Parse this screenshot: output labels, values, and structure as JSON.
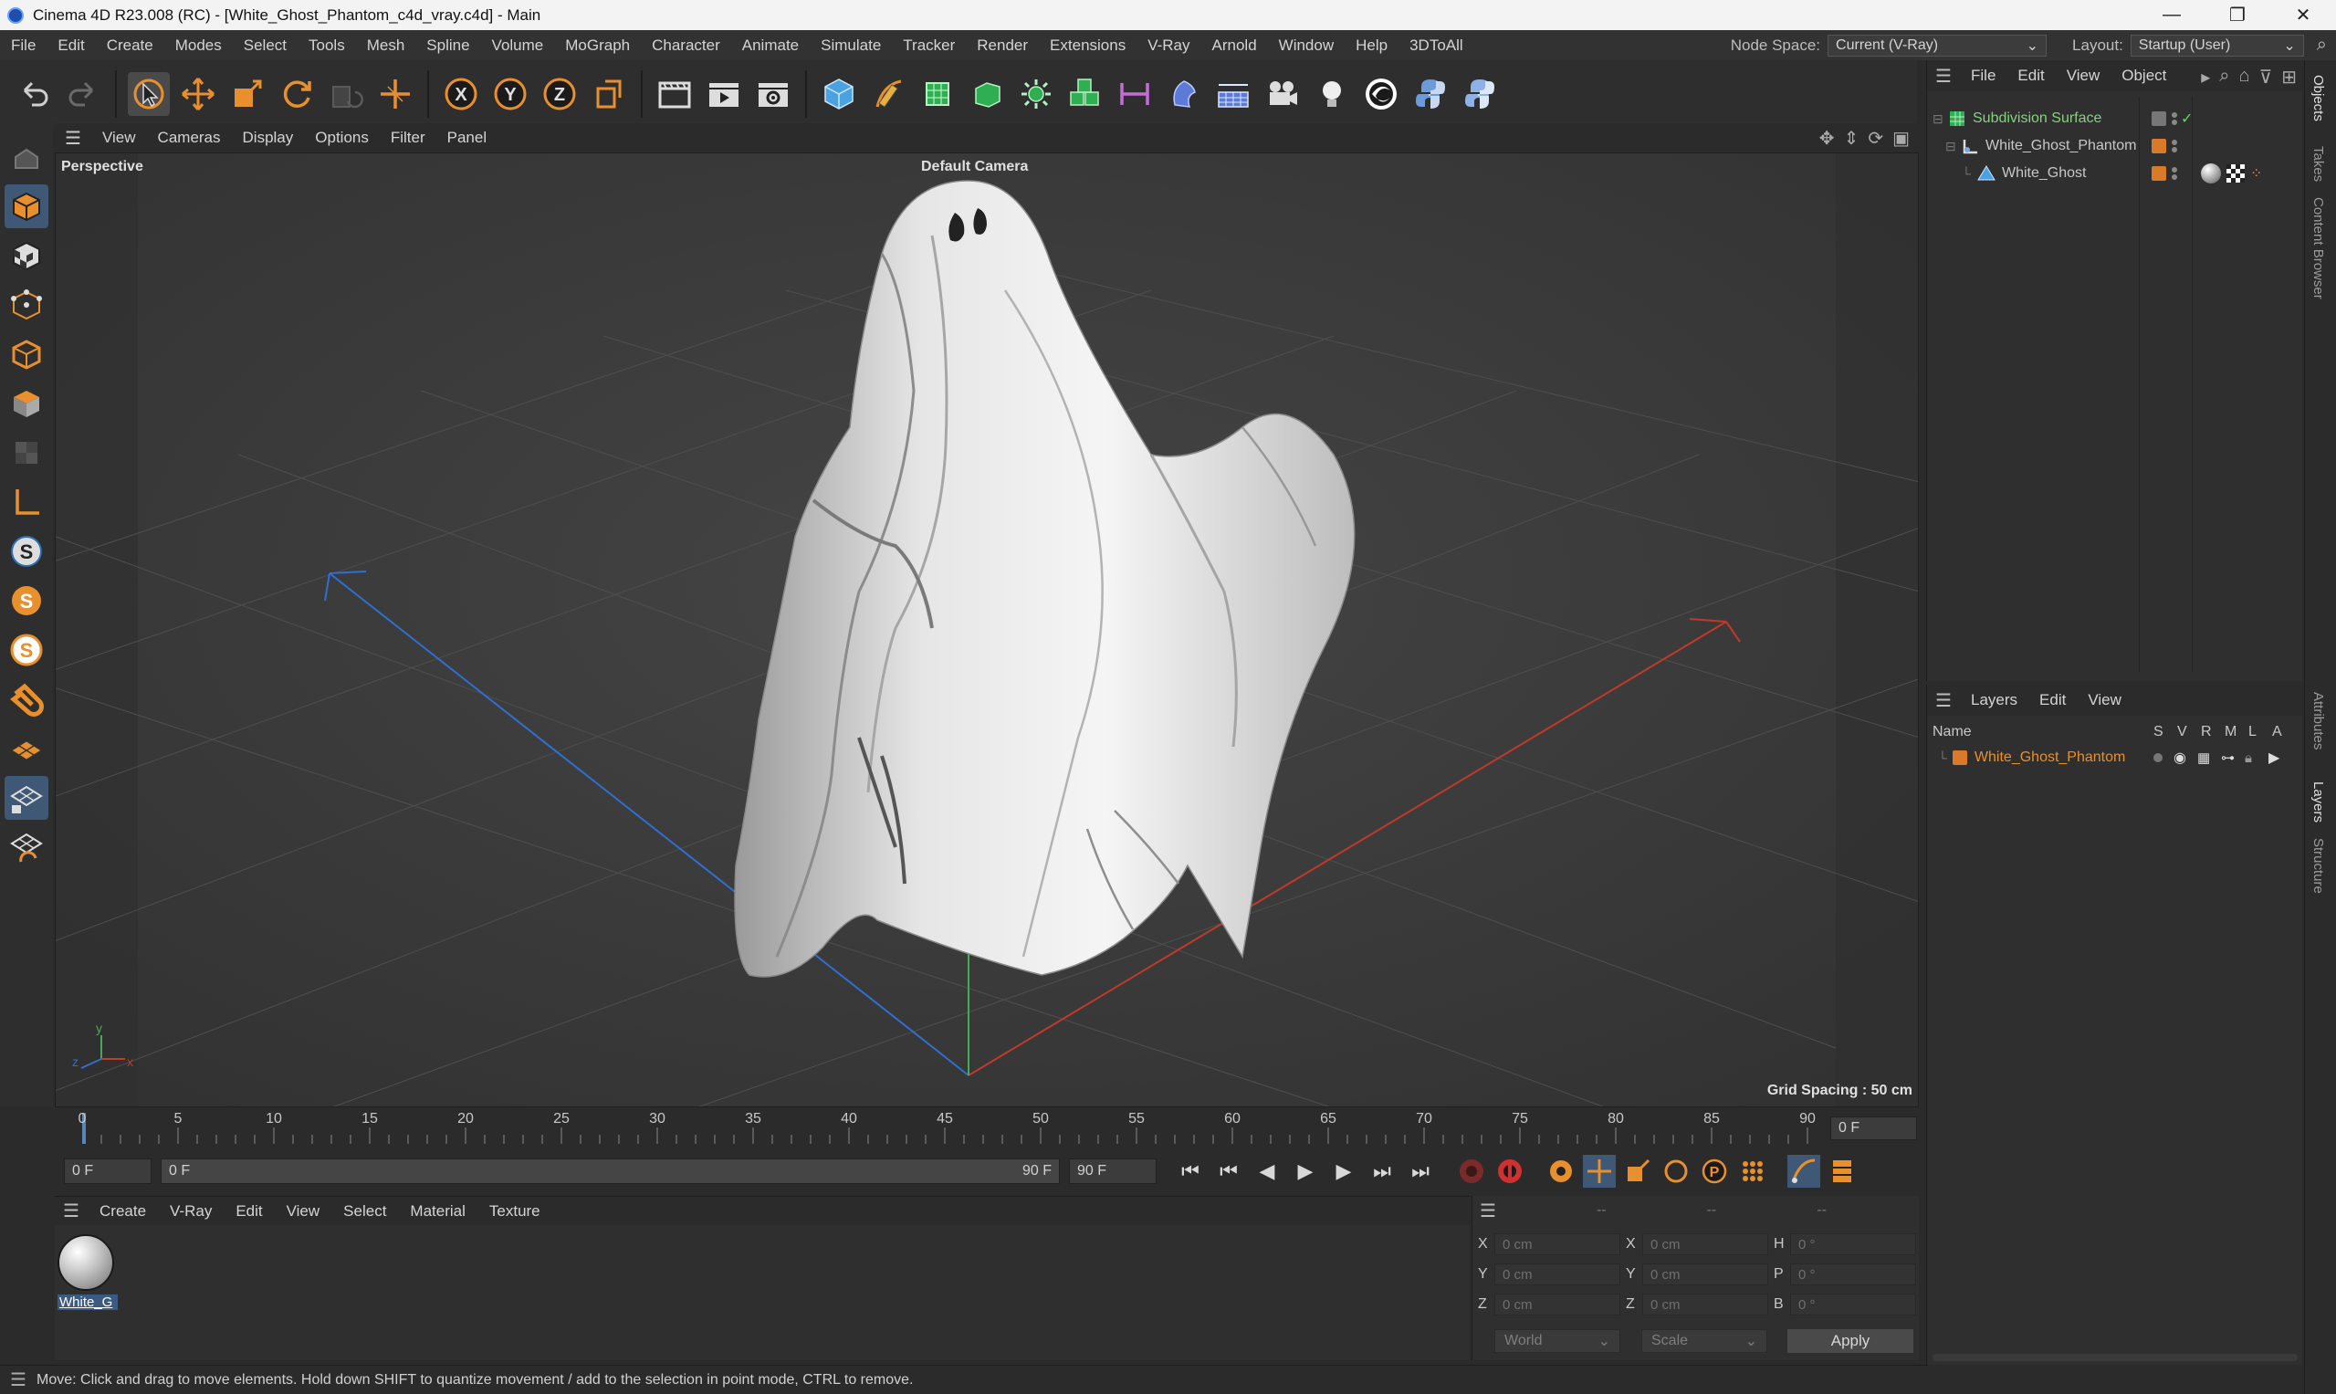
{
  "window": {
    "title": "Cinema 4D R23.008 (RC) - [White_Ghost_Phantom_c4d_vray.c4d] - Main",
    "controls": [
      "—",
      "❐",
      "✕"
    ]
  },
  "menubar": {
    "items": [
      "File",
      "Edit",
      "Create",
      "Modes",
      "Select",
      "Tools",
      "Mesh",
      "Spline",
      "Volume",
      "MoGraph",
      "Character",
      "Animate",
      "Simulate",
      "Tracker",
      "Render",
      "Extensions",
      "V-Ray",
      "Arnold",
      "Window",
      "Help",
      "3DToAll"
    ],
    "node_space_label": "Node Space:",
    "node_space_value": "Current (V-Ray)",
    "layout_label": "Layout:",
    "layout_value": "Startup (User)"
  },
  "toolbar": {
    "icons": [
      "undo-icon",
      "redo-icon",
      "select-arrow-icon",
      "move-icon",
      "scale-icon",
      "rotate-icon",
      "recent-tool-icon",
      "live-select-icon",
      "x-axis-icon",
      "y-axis-icon",
      "z-axis-icon",
      "coordinate-system-icon",
      "render-region-icon",
      "render-view-icon",
      "render-settings-icon",
      "cube-icon",
      "pen-icon",
      "subdivision-icon",
      "extrude-icon",
      "cloner-icon",
      "boole-icon",
      "symmetry-icon",
      "deformer-icon",
      "floor-icon",
      "camera-icon",
      "light-icon",
      "vray-icon",
      "python-icon",
      "python-script-icon"
    ]
  },
  "lefttools": {
    "icons": [
      "make-editable-icon",
      "model-mode-icon",
      "texture-mode-icon",
      "points-mode-icon",
      "edges-mode-icon",
      "polygons-mode-icon",
      "uv-mode-icon",
      "axis-mode-icon",
      "snap-s-icon",
      "snap-s2-icon",
      "snap-s3-icon",
      "magnet-icon",
      "workplane-icon",
      "workplane-lock-icon",
      "workplane-snap-icon"
    ]
  },
  "viewport": {
    "menu": [
      "View",
      "Cameras",
      "Display",
      "Options",
      "Filter",
      "Panel"
    ],
    "view_name": "Perspective",
    "camera": "Default Camera",
    "grid_spacing": "Grid Spacing : 50 cm"
  },
  "timeline": {
    "ticks": [
      "0",
      "5",
      "10",
      "15",
      "20",
      "25",
      "30",
      "35",
      "40",
      "45",
      "50",
      "55",
      "60",
      "65",
      "70",
      "75",
      "80",
      "85",
      "90"
    ],
    "current_frame": "0 F"
  },
  "playbar": {
    "start": "0 F",
    "range_start": "0 F",
    "range_end": "90 F",
    "end": "90 F"
  },
  "material_manager": {
    "menu": [
      "Create",
      "V-Ray",
      "Edit",
      "View",
      "Select",
      "Material",
      "Texture"
    ],
    "materials": [
      {
        "name": "White_G"
      }
    ]
  },
  "coordinates": {
    "header": [
      "--",
      "--",
      "--"
    ],
    "rows": [
      {
        "a": "X",
        "av": "0 cm",
        "b": "X",
        "bv": "0 cm",
        "c": "H",
        "cv": "0 °"
      },
      {
        "a": "Y",
        "av": "0 cm",
        "b": "Y",
        "bv": "0 cm",
        "c": "P",
        "cv": "0 °"
      },
      {
        "a": "Z",
        "av": "0 cm",
        "b": "Z",
        "bv": "0 cm",
        "c": "B",
        "cv": "0 °"
      }
    ],
    "mode": "World",
    "transform": "Scale",
    "apply": "Apply"
  },
  "status": {
    "message": "Move: Click and drag to move elements. Hold down SHIFT to quantize movement / add to the selection in point mode, CTRL to remove."
  },
  "object_manager": {
    "menu": [
      "File",
      "Edit",
      "View",
      "Object"
    ],
    "objects": [
      {
        "name": "Subdivision Surface"
      },
      {
        "name": "White_Ghost_Phantom"
      },
      {
        "name": "White_Ghost"
      }
    ]
  },
  "layer_manager": {
    "menu": [
      "Layers",
      "Edit",
      "View"
    ],
    "columns": [
      "Name",
      "S",
      "V",
      "R",
      "M",
      "L",
      "A"
    ],
    "layers": [
      {
        "name": "White_Ghost_Phantom"
      }
    ]
  },
  "right_dock": {
    "tabs": [
      "Objects",
      "Takes",
      "Content Browser",
      "Attributes",
      "Layers",
      "Structure"
    ]
  },
  "colors": {
    "accent_orange": "#d97a2b",
    "green_object": "#86d07e",
    "axis_x": "#c0392b",
    "axis_z": "#2f6fd0",
    "axis_y": "#3fae55"
  }
}
